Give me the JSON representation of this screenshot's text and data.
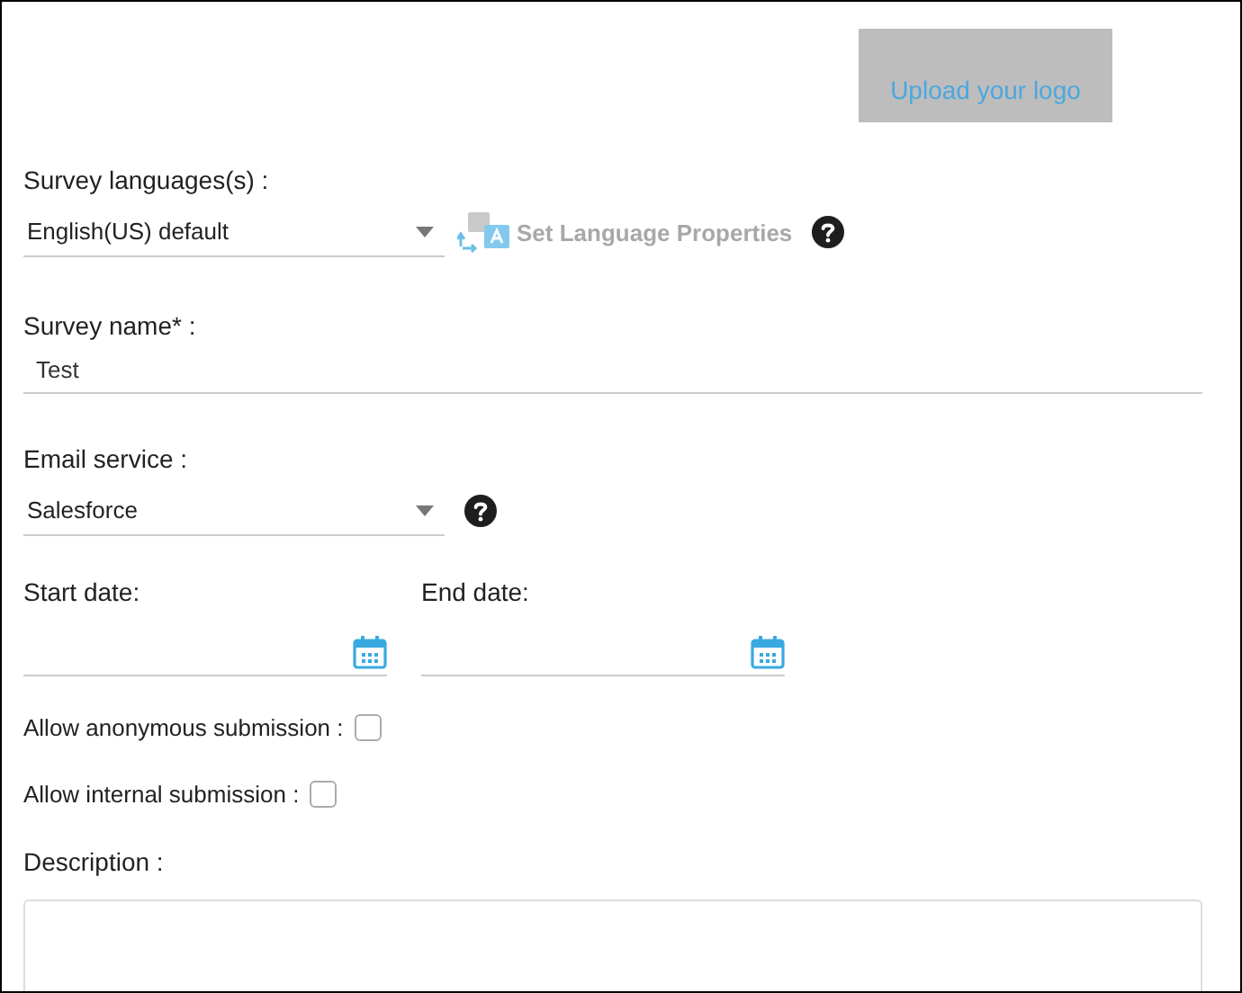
{
  "logo": {
    "label": "Upload your logo"
  },
  "languages": {
    "label": "Survey languages(s) :",
    "value": "English(US) default",
    "action": {
      "label": "Set Language Properties",
      "disabled": true
    }
  },
  "survey_name": {
    "label": "Survey name* :",
    "value": "Test"
  },
  "email_service": {
    "label": "Email service :",
    "value": "Salesforce"
  },
  "start_date": {
    "label": "Start date:"
  },
  "end_date": {
    "label": "End date:"
  },
  "options": [
    {
      "label": "Allow anonymous submission :",
      "checked": false
    },
    {
      "label": "Allow internal submission :",
      "checked": false
    }
  ],
  "description": {
    "label": "Description :"
  }
}
